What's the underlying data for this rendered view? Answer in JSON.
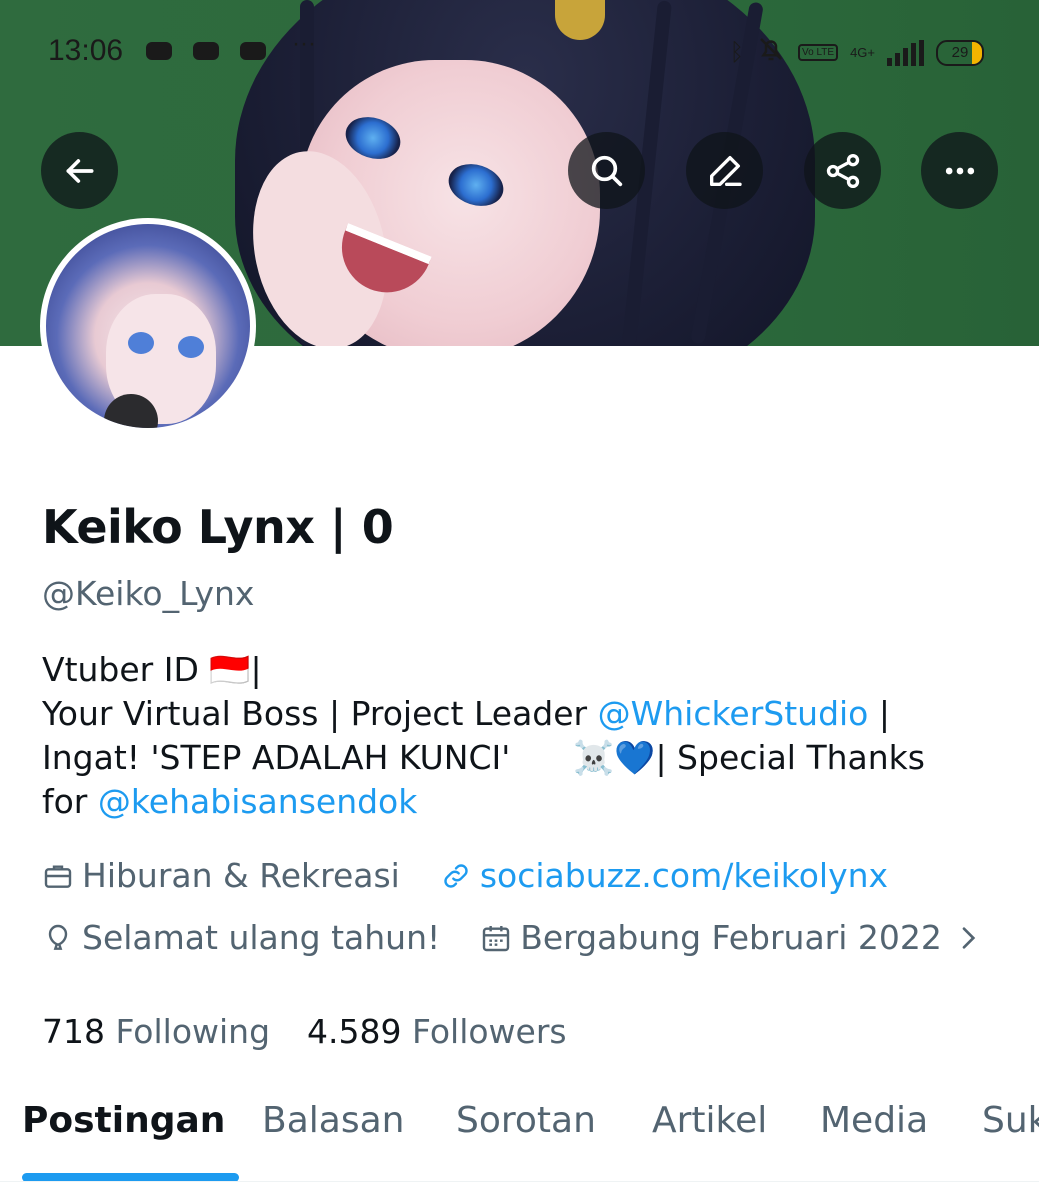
{
  "status_bar": {
    "time": "13:06",
    "more_dots": "···",
    "network": "4G+",
    "volte": "Vo LTE",
    "battery": "29"
  },
  "header_actions": {
    "back": "back-arrow-icon",
    "search": "search-icon",
    "edit": "edit-icon",
    "share": "share-icon",
    "more": "more-icon"
  },
  "profile": {
    "name": "Keiko Lynx | 0",
    "handle": "@Keiko_Lynx",
    "bio": {
      "line1": "Vtuber ID 🇮🇩|",
      "line2_prefix": "Your Virtual Boss | Project Leader ",
      "line2_mention": "@WhickerStudio",
      "line2_suffix": " |",
      "line3": "Ingat! 'STEP ADALAH KUNCI'      ☠️💙| Special Thanks",
      "line4_prefix": "for ",
      "line4_mention": "@kehabisansendok"
    },
    "category": "Hiburan & Rekreasi",
    "website": "sociabuzz.com/keikolynx",
    "birthday": "Selamat ulang tahun!",
    "joined": "Bergabung Februari 2022",
    "following_count": "718",
    "following_label": "Following",
    "followers_count": "4.589",
    "followers_label": "Followers"
  },
  "tabs": [
    {
      "label": "Postingan"
    },
    {
      "label": "Balasan"
    },
    {
      "label": "Sorotan"
    },
    {
      "label": "Artikel"
    },
    {
      "label": "Media"
    },
    {
      "label": "Suka"
    }
  ],
  "colors": {
    "accent": "#1d9bf0",
    "secondary_text": "#536471",
    "banner_green": "#2c6a3c"
  }
}
